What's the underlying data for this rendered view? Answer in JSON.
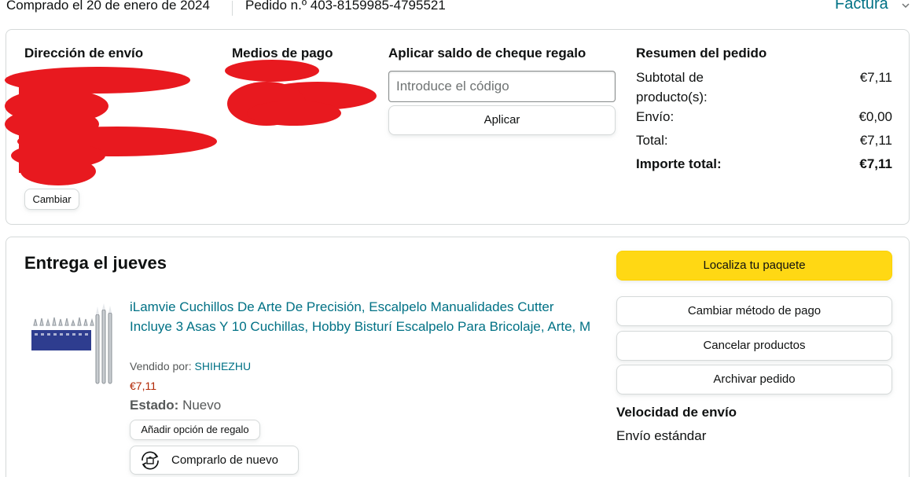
{
  "order_header": {
    "purchase_date": "Comprado el 20 de enero de 2024",
    "order_number": "Pedido n.º 403-8159985-4795521",
    "invoice_label": "Factura"
  },
  "shipping": {
    "title": "Dirección de envío",
    "change_label": "Cambiar"
  },
  "payment": {
    "title": "Medios de pago"
  },
  "gift_card": {
    "title": "Aplicar saldo de cheque regalo",
    "placeholder": "Introduce el código",
    "apply_label": "Aplicar"
  },
  "summary": {
    "title": "Resumen del pedido",
    "rows": [
      {
        "label": "Subtotal de producto(s):",
        "value": "€7,11"
      },
      {
        "label": "Envío:",
        "value": "€0,00"
      },
      {
        "label": "Total:",
        "value": "€7,11"
      },
      {
        "label": "Importe total:",
        "value": "€7,11"
      }
    ],
    "subtotal_line1": "Subtotal de",
    "subtotal_line2": "producto(s):"
  },
  "delivery": {
    "title": "Entrega el jueves",
    "product": {
      "title": "iLamvie Cuchillos De Arte De Precisión, Escalpelo Manualidades Cutter Incluye 3 Asas Y 10 Cuchillas, Hobby Bisturí Escalpelo Para Bricolaje, Arte, M",
      "seller_prefix": "Vendido por: ",
      "seller_name": "SHIHEZHU",
      "price": "€7,11",
      "condition_label": "Estado:",
      "condition_value": " Nuevo",
      "gift_option_label": "Añadir opción de regalo",
      "buy_again_label": "Comprarlo de nuevo"
    },
    "actions": {
      "track": "Localiza tu paquete",
      "change_payment": "Cambiar método de pago",
      "cancel": "Cancelar productos",
      "archive": "Archivar pedido"
    },
    "speed": {
      "title": "Velocidad de envío",
      "value": "Envío estándar"
    }
  },
  "colors": {
    "link": "#007185",
    "price": "#B12704",
    "primary_button": "#FFD814",
    "redaction": "#E8191F",
    "border": "#D5D9D9"
  }
}
